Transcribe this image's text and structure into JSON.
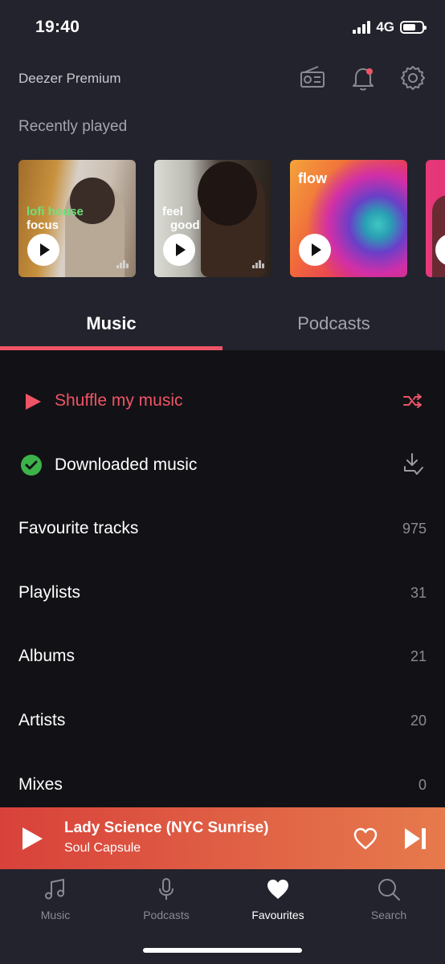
{
  "status_bar": {
    "time": "19:40",
    "network": "4G",
    "battery_level": 0.7
  },
  "header": {
    "account_label": "Deezer Premium",
    "icons": [
      "radio-icon",
      "bell-icon",
      "gear-icon"
    ],
    "notification_dot_color": "#ef5466"
  },
  "recently_played": {
    "title": "Recently played",
    "cards": [
      {
        "line1": "lofi house",
        "line2": "focus",
        "line1_color": "#6ee27a"
      },
      {
        "line1": "feel",
        "line2": "good"
      },
      {
        "line1": "flow"
      },
      {
        "line1": ""
      }
    ]
  },
  "tabs": [
    {
      "label": "Music",
      "active": true
    },
    {
      "label": "Podcasts",
      "active": false
    }
  ],
  "library": {
    "shuffle_label": "Shuffle my music",
    "downloaded_label": "Downloaded music",
    "items": [
      {
        "label": "Favourite tracks",
        "count": "975"
      },
      {
        "label": "Playlists",
        "count": "31"
      },
      {
        "label": "Albums",
        "count": "21"
      },
      {
        "label": "Artists",
        "count": "20"
      },
      {
        "label": "Mixes",
        "count": "0"
      }
    ]
  },
  "player": {
    "title": "Lady Science (NYC Sunrise)",
    "artist": "Soul Capsule",
    "icons": [
      "play-icon",
      "heart-icon",
      "skip-next-icon"
    ]
  },
  "nav": [
    {
      "label": "Music",
      "icon": "music-note-icon",
      "active": false
    },
    {
      "label": "Podcasts",
      "icon": "microphone-icon",
      "active": false
    },
    {
      "label": "Favourites",
      "icon": "heart-icon",
      "active": true
    },
    {
      "label": "Search",
      "icon": "search-icon",
      "active": false
    }
  ],
  "colors": {
    "accent": "#ef5466",
    "background_top": "#23232d",
    "background_list": "#121216",
    "download_check": "#3cb34a"
  }
}
